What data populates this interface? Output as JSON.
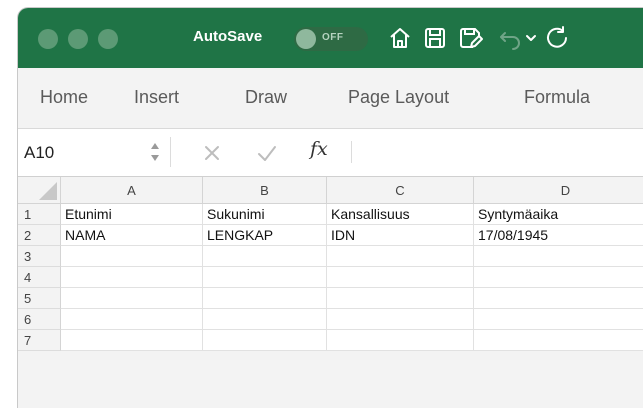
{
  "titlebar": {
    "autosave_label": "AutoSave",
    "autosave_state": "OFF"
  },
  "ribbon": {
    "tabs": [
      "Home",
      "Insert",
      "Draw",
      "Page Layout",
      "Formula"
    ]
  },
  "formula_bar": {
    "name_box": "A10",
    "fx_label": "fx",
    "content": ""
  },
  "sheet": {
    "columns": [
      "A",
      "B",
      "C",
      "D"
    ],
    "rows": [
      {
        "num": "1",
        "cells": [
          "Etunimi",
          "Sukunimi",
          "Kansallisuus",
          "Syntymäaika"
        ]
      },
      {
        "num": "2",
        "cells": [
          "NAMA",
          "LENGKAP",
          "IDN",
          "17/08/1945"
        ]
      },
      {
        "num": "3",
        "cells": [
          "",
          "",
          "",
          ""
        ]
      },
      {
        "num": "4",
        "cells": [
          "",
          "",
          "",
          ""
        ]
      },
      {
        "num": "5",
        "cells": [
          "",
          "",
          "",
          ""
        ]
      },
      {
        "num": "6",
        "cells": [
          "",
          "",
          "",
          ""
        ]
      },
      {
        "num": "7",
        "cells": [
          "",
          "",
          "",
          ""
        ]
      }
    ]
  },
  "colors": {
    "titlebar": "#1f7446",
    "ribbon": "#f3f3f3"
  }
}
